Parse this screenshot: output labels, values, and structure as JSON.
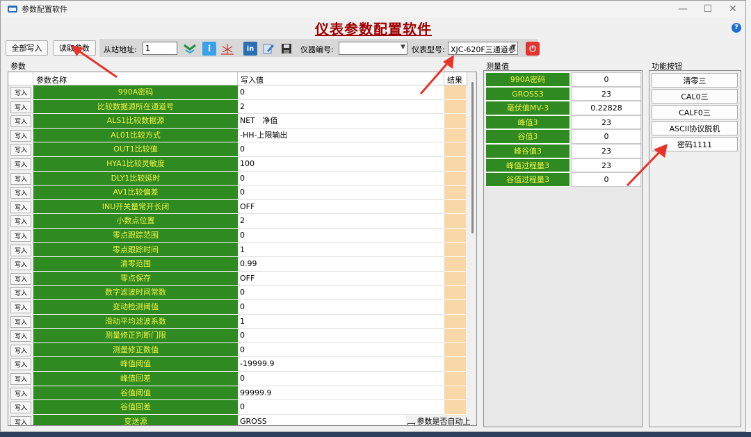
{
  "window": {
    "title": "参数配置软件",
    "minimize": "—",
    "maximize": "☐",
    "close": "✕"
  },
  "heading": "仪表参数配置软件",
  "help_icon": "?",
  "toolbar": {
    "write_all": "全部写入",
    "read_params": "读取参数",
    "slave_label": "从站地址:",
    "slave_value": "1",
    "device_no_label": "仪器编号:",
    "device_no_value": "",
    "model_label": "仪表型号:",
    "model_value": "XJC-620F三通道参",
    "icons": [
      "connect-icon",
      "info-icon",
      "antenna-icon",
      "linkedin-icon",
      "edit-icon",
      "save-icon",
      "power-icon"
    ]
  },
  "params": {
    "group_label": "参数",
    "col_name": "参数名称",
    "col_value": "写入值",
    "col_result": "结果",
    "write_btn": "写入",
    "rows": [
      {
        "name": "990A密码",
        "value": "0"
      },
      {
        "name": "比较数据源所在通道号",
        "value": "2"
      },
      {
        "name": "ALS1比较数据源",
        "value": "NET   净值"
      },
      {
        "name": "AL01比较方式",
        "value": "-HH-上限输出"
      },
      {
        "name": "OUT1比较值",
        "value": "0"
      },
      {
        "name": "HYA1比较灵敏度",
        "value": "100"
      },
      {
        "name": "DLY1比较延时",
        "value": "0"
      },
      {
        "name": "AV1比较偏差",
        "value": "0"
      },
      {
        "name": "INU开关量常开长闭",
        "value": "OFF"
      },
      {
        "name": "小数点位置",
        "value": "2"
      },
      {
        "name": "零点跟踪范围",
        "value": "0"
      },
      {
        "name": "零点跟踪时间",
        "value": "1"
      },
      {
        "name": "清零范围",
        "value": "0.99"
      },
      {
        "name": "零点保存",
        "value": "OFF"
      },
      {
        "name": "数字滤波时间常数",
        "value": "0"
      },
      {
        "name": "变动检测阈值",
        "value": "0"
      },
      {
        "name": "滑动平均滤波系数",
        "value": "1"
      },
      {
        "name": "测量修正判断门限",
        "value": "0"
      },
      {
        "name": "测量修正数值",
        "value": "0"
      },
      {
        "name": "峰值阈值",
        "value": "-19999.9"
      },
      {
        "name": "峰值回差",
        "value": "0"
      },
      {
        "name": "谷值阈值",
        "value": "99999.9"
      },
      {
        "name": "谷值回差",
        "value": "0"
      },
      {
        "name": "变送源",
        "value": "GROSS"
      }
    ],
    "auto_upload": "参数是否自动上传"
  },
  "measure": {
    "group_label": "测量值",
    "rows": [
      {
        "name": "990A密码",
        "value": "0"
      },
      {
        "name": "GROSS3",
        "value": "23"
      },
      {
        "name": "毫伏值MV-3",
        "value": "0.22828"
      },
      {
        "name": "峰值3",
        "value": "23"
      },
      {
        "name": "谷值3",
        "value": "0"
      },
      {
        "name": "峰谷值3",
        "value": "23"
      },
      {
        "name": "峰值过程量3",
        "value": "23"
      },
      {
        "name": "谷值过程量3",
        "value": "0"
      }
    ]
  },
  "functions": {
    "group_label": "功能按钮",
    "buttons": [
      "清零三",
      "CAL0三",
      "CALF0三",
      "ASCII协议脱机",
      "密码1111"
    ]
  },
  "colors": {
    "name_cell": "#2e8a21",
    "name_text": "#f2f245",
    "result_cell": "#f8d7a8",
    "heading": "#a00000",
    "annotation_arrow": "#e8322a"
  }
}
